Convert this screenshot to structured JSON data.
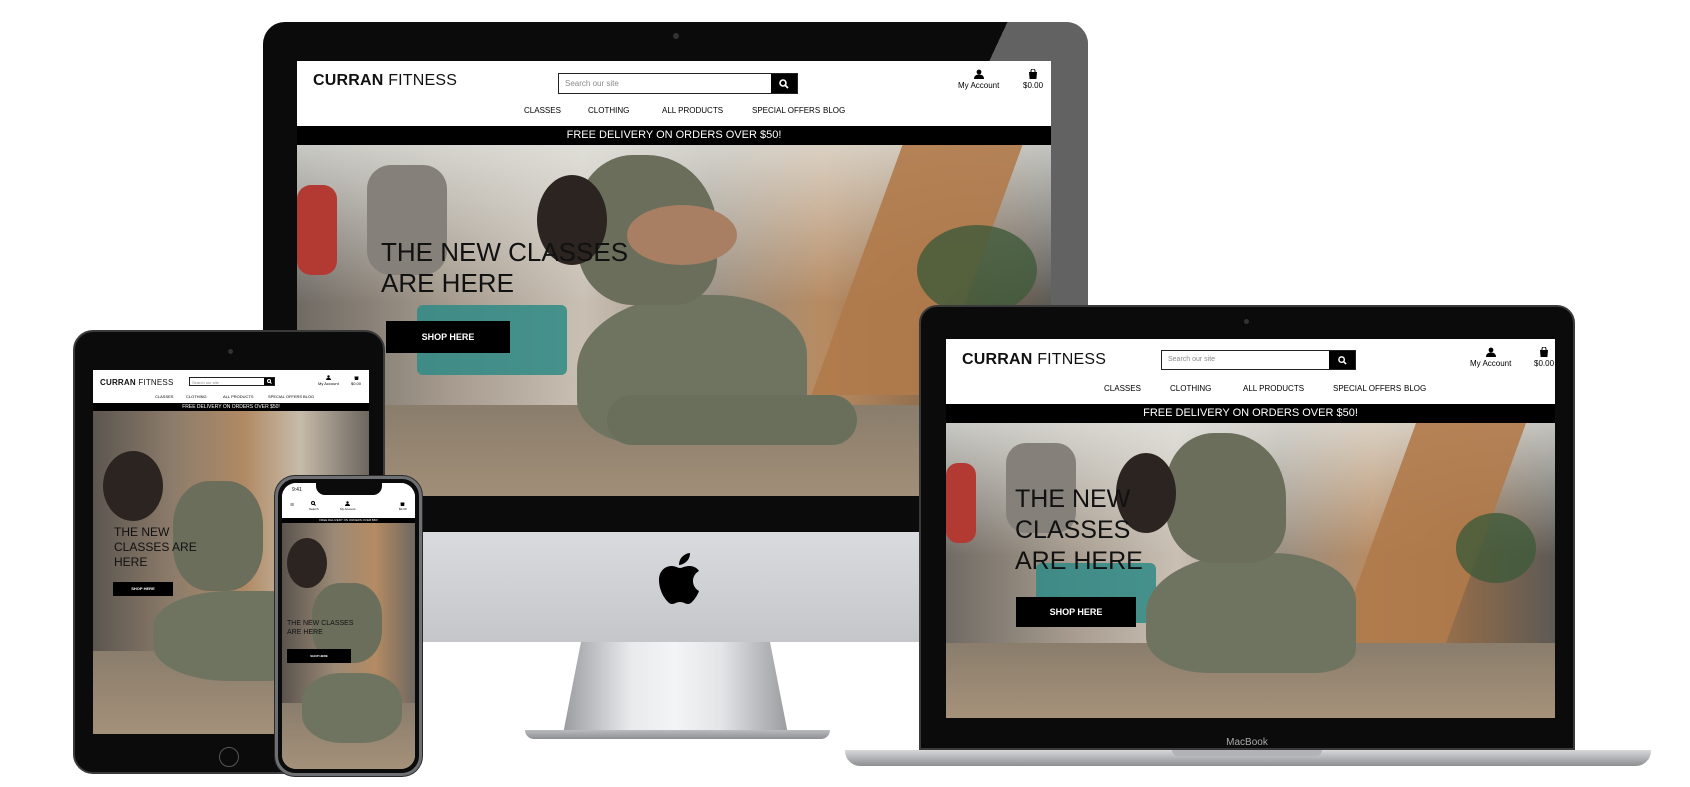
{
  "site": {
    "brand_bold": "CURRAN",
    "brand_light": "FITNESS",
    "search_placeholder": "Search our site",
    "account_label": "My Account",
    "bag_total": "$0.00",
    "nav": [
      "CLASSES",
      "CLOTHING",
      "ALL PRODUCTS",
      "SPECIAL OFFERS",
      "BLOG"
    ],
    "banner": "FREE DELIVERY ON ORDERS OVER $50!",
    "hero_title": "THE NEW CLASSES ARE HERE",
    "cta": "SHOP HERE"
  },
  "phone": {
    "clock": "9:41",
    "search_label": "Search"
  },
  "laptop": {
    "brand_label": "MacBook"
  },
  "icons": {
    "search": "search-icon",
    "account": "user-icon",
    "bag": "shopping-bag-icon",
    "menu": "hamburger-menu-icon",
    "apple": "apple-logo-icon"
  },
  "colors": {
    "banner_bg": "#000000",
    "cta_bg": "#000000",
    "device_frame": "#0b0b0b",
    "imac_chin": "#cfd1d4"
  }
}
